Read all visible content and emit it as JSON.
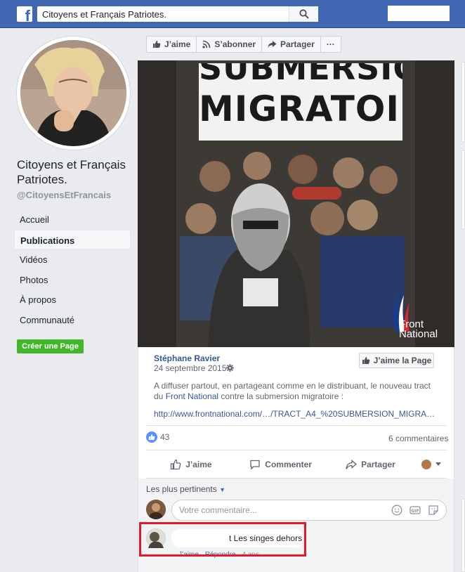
{
  "search": {
    "value": "Citoyens et Français Patriotes."
  },
  "page": {
    "name": "Citoyens et Français Patriotes.",
    "handle": "@CitoyensEtFrancais"
  },
  "nav": [
    {
      "label": "Accueil",
      "active": false
    },
    {
      "label": "Publications",
      "active": true
    },
    {
      "label": "Vidéos",
      "active": false
    },
    {
      "label": "Photos",
      "active": false
    },
    {
      "label": "À propos",
      "active": false
    },
    {
      "label": "Communauté",
      "active": false
    }
  ],
  "create_page_label": "Créer une Page",
  "action_bar": {
    "like": "J’aime",
    "follow": "S’abonner",
    "share": "Partager",
    "more": "···"
  },
  "poster": {
    "line1": "SUBMERSION",
    "line2": "MIGRATOIRE",
    "logo_line1": "Front",
    "logo_line2": "National"
  },
  "post": {
    "author": "Stéphane Ravier",
    "date": "24 septembre 2015 ·",
    "like_page": "J’aime la Page",
    "text_before": "A diffuser partout, en partageant comme en le distribuant, le nouveau tract du ",
    "text_link": "Front National",
    "text_after": " contre la submersion migratoire :",
    "url": "http://www.frontnational.com/…/TRACT_A4_%20SUBMERSION_MIGRA…",
    "likes": "43",
    "comments_count": "6 commentaires"
  },
  "reaction_bar": {
    "like": "J’aime",
    "comment": "Commenter",
    "share": "Partager"
  },
  "comments": {
    "sort_label": "Les plus pertinents",
    "input_placeholder": "Votre commentaire...",
    "items": [
      {
        "text": "t Les singes dehors",
        "meta_like": "J’aime",
        "meta_reply": "Répondre",
        "meta_time": "4 ans"
      }
    ]
  },
  "colors": {
    "facebook_blue": "#4267b2",
    "green_button": "#42b72a",
    "highlight_red": "#e3192c"
  }
}
